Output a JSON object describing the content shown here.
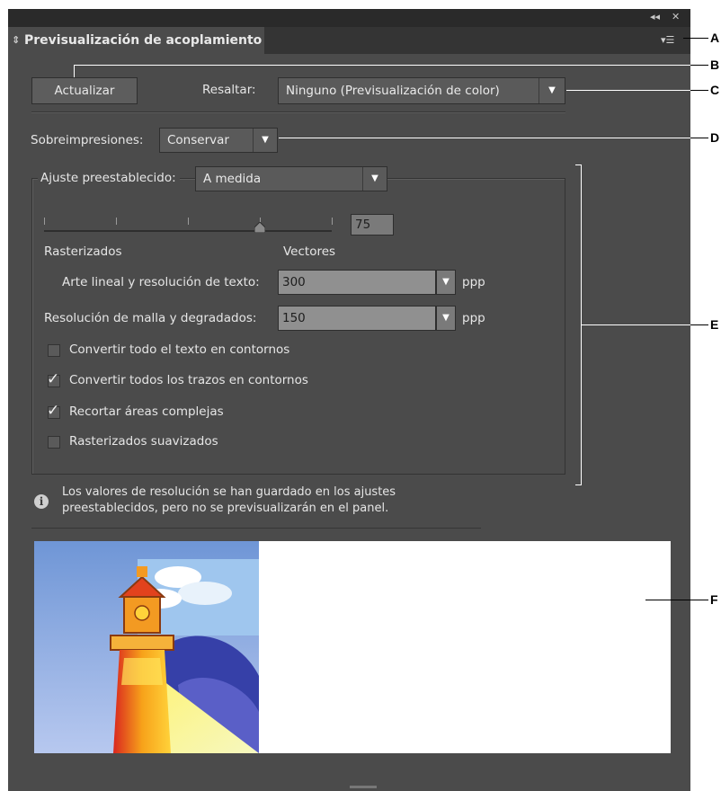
{
  "panel": {
    "title": "Previsualización de acoplamiento",
    "collapse_glyph": "◂◂",
    "close_glyph": "✕",
    "menu_glyph": "▾☰",
    "sort_glyph": "⇕"
  },
  "toolbar": {
    "refresh_label": "Actualizar",
    "highlight_label": "Resaltar:",
    "highlight_value": "Ninguno (Previsualización de color)"
  },
  "overprint": {
    "label": "Sobreimpresiones:",
    "value": "Conservar"
  },
  "preset": {
    "label": "Ajuste preestablecido:",
    "value": "A medida",
    "slider_value": "75",
    "slider_fraction": 0.75,
    "left_label": "Rasterizados",
    "right_label": "Vectores",
    "lineart_label": "Arte lineal y resolución de texto:",
    "lineart_value": "300",
    "lineart_unit": "ppp",
    "mesh_label": "Resolución de malla y degradados:",
    "mesh_value": "150",
    "mesh_unit": "ppp",
    "options": [
      {
        "label": "Convertir todo el texto en contornos",
        "checked": false
      },
      {
        "label": "Convertir todos los trazos en contornos",
        "checked": true
      },
      {
        "label": "Recortar áreas complejas",
        "checked": true
      },
      {
        "label": "Rasterizados suavizados",
        "checked": false
      }
    ]
  },
  "info": {
    "line1": "Los valores de resolución se han guardado en los ajustes",
    "line2": "preestablecidos, pero no se previsualizarán en el panel."
  },
  "callouts": {
    "a": "A",
    "b": "B",
    "c": "C",
    "d": "D",
    "e": "E",
    "f": "F"
  },
  "colors": {
    "panel_bg": "#4b4b4b",
    "title_bar": "#2a2a2a",
    "field_bg": "#909090",
    "preview_bg": "#ffffff"
  }
}
